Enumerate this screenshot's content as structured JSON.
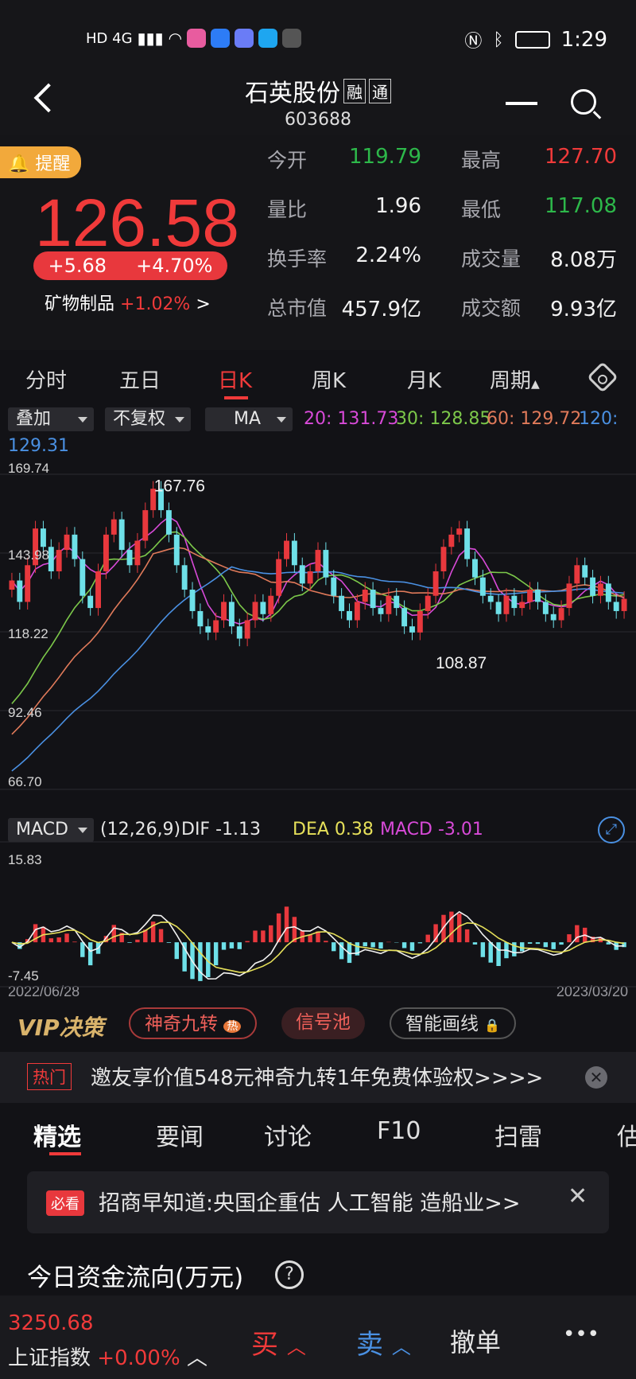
{
  "status_bar": {
    "left_text": "HD 4G",
    "time": "1:29"
  },
  "header": {
    "title": "石英股份",
    "tag1": "融",
    "tag2": "通",
    "code": "603688"
  },
  "quote": {
    "remind_label": "提醒",
    "price": "126.58",
    "change": "+5.68",
    "change_pct": "+4.70%",
    "sector": "矿物制品",
    "sector_pct": "+1.02%",
    "sector_arrow": ">",
    "stats": [
      {
        "label": "今开",
        "value": "119.79",
        "color": "green"
      },
      {
        "label": "最高",
        "value": "127.70",
        "color": "red"
      },
      {
        "label": "量比",
        "value": "1.96",
        "color": "white"
      },
      {
        "label": "最低",
        "value": "117.08",
        "color": "green"
      },
      {
        "label": "换手率",
        "value": "2.24%",
        "color": "white"
      },
      {
        "label": "成交量",
        "value": "8.08万",
        "color": "white"
      },
      {
        "label": "总市值",
        "value": "457.9亿",
        "color": "white"
      },
      {
        "label": "成交额",
        "value": "9.93亿",
        "color": "white"
      }
    ]
  },
  "chart_tabs": [
    "分时",
    "五日",
    "日K",
    "周K",
    "月K",
    "周期"
  ],
  "indicator_bar": {
    "overlay": "叠加",
    "adjust": "不复权",
    "ma": "MA",
    "ma20": "20: 131.73",
    "ma30": "30: 128.85",
    "ma60": "60: 129.72",
    "ma120_label": "120:",
    "ma120_value": "129.31",
    "colors": {
      "ma20": "#d84ad8",
      "ma30": "#7cc84a",
      "ma60": "#e07a5a",
      "ma120": "#4a90e2"
    }
  },
  "chart_data": {
    "type": "candlestick",
    "y_ticks": [
      "169.74",
      "143.98",
      "118.22",
      "92.46",
      "66.70"
    ],
    "ylim": [
      66.7,
      169.74
    ],
    "high_annotation": "167.76",
    "low_annotation": "108.87",
    "x_start": "2022/06/28",
    "x_end": "2023/03/20",
    "closes": [
      135,
      128,
      140,
      152,
      146,
      138,
      145,
      150,
      142,
      130,
      126,
      138,
      150,
      155,
      145,
      140,
      148,
      158,
      165,
      158,
      150,
      140,
      132,
      125,
      120,
      118,
      122,
      128,
      120,
      116,
      122,
      128,
      124,
      130,
      142,
      148,
      140,
      134,
      138,
      145,
      136,
      130,
      125,
      122,
      128,
      132,
      126,
      124,
      130,
      126,
      120,
      118,
      125,
      130,
      138,
      146,
      150,
      152,
      142,
      136,
      130,
      128,
      124,
      130,
      126,
      128,
      132,
      128,
      124,
      122,
      126,
      134,
      140,
      136,
      130,
      134,
      128,
      125,
      129
    ],
    "macd_label": "MACD",
    "macd_params": "(12,26,9)",
    "dif": "DIF -1.13",
    "dea": "DEA 0.38",
    "macd": "MACD -3.01",
    "macd_ylim": [
      -7.45,
      15.83
    ],
    "macd_ticks": [
      "15.83",
      "-7.45"
    ]
  },
  "tools": {
    "vip": "VIP决策",
    "p1": "神奇九转",
    "p1_badge": "热",
    "p2": "信号池",
    "p3": "智能画线"
  },
  "hot": {
    "tag": "热门",
    "text": "邀友享价值548元神奇九转1年免费体验权>>>>"
  },
  "bottom_tabs": [
    "精选",
    "要闻",
    "讨论",
    "F10",
    "扫雷",
    "估"
  ],
  "notice": {
    "tag": "必看",
    "text": "招商早知道:央国企重估 人工智能 造船业>>"
  },
  "flow": {
    "title": "今日资金流向(万元)",
    "help": "?"
  },
  "footer": {
    "index_value": "3250.68",
    "index_name": "上证指数",
    "index_pct": "+0.00%",
    "buy": "买",
    "sell": "卖",
    "cancel": "撤单",
    "more": "•••"
  }
}
